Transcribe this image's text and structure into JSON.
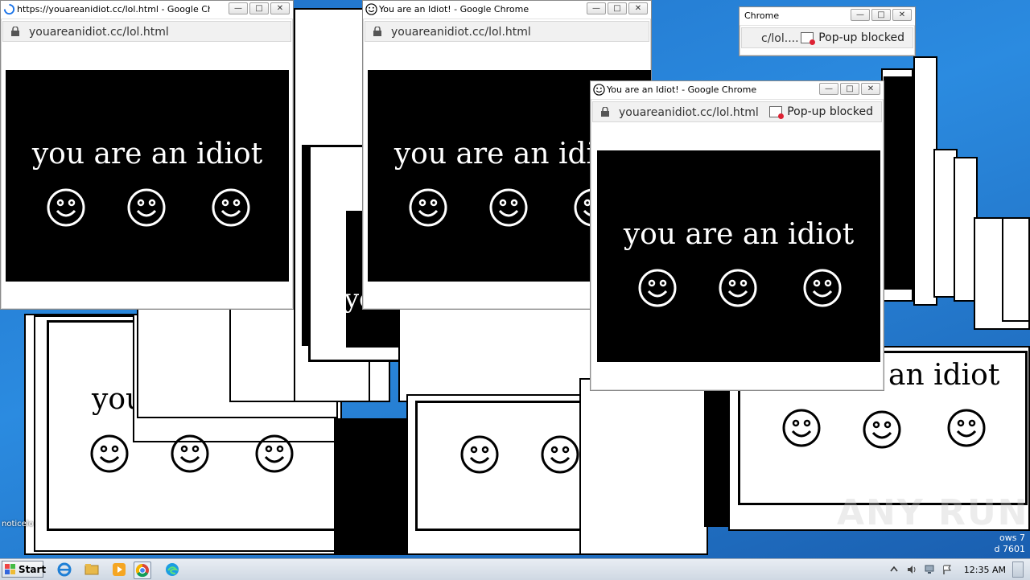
{
  "windows": [
    {
      "title": "https://youareanidiot.cc/lol.html - Google Chrome",
      "url": "youareanidiot.cc/lol.html",
      "message": "you are an idiot",
      "popup_blocked": ""
    },
    {
      "title": "You are an Idiot! - Google Chrome",
      "url": "youareanidiot.cc/lol.html",
      "message": "you are an idiot",
      "popup_blocked": ""
    },
    {
      "title": "You are an Idiot! - Google Chrome",
      "url": "youareanidiot.cc/lol.html",
      "message": "you are an idiot",
      "popup_blocked": "Pop-up blocked"
    },
    {
      "title": "Chrome",
      "url": "c/lol....",
      "popup_blocked": "Pop-up blocked"
    }
  ],
  "background_text": {
    "frag1": "you are an idiot",
    "frag2": "an idiot",
    "frag3": "you"
  },
  "window_controls": {
    "minimize": "—",
    "maximize": "□",
    "close": "✕"
  },
  "taskbar": {
    "start_label": "Start",
    "clock": "12:35 AM",
    "pinned": [
      "ie-icon",
      "explorer-icon",
      "media-player-icon",
      "chrome-icon",
      "edge-icon"
    ]
  },
  "desktop": {
    "icon_label": "noticelo",
    "os_label_line1": "ows 7",
    "os_label_line2": "d 7601",
    "watermark": "ANY RUN"
  },
  "colors": {
    "popup_bg": "#000000",
    "popup_text": "#ffffff",
    "desktop_bg": "#2b8be0"
  }
}
